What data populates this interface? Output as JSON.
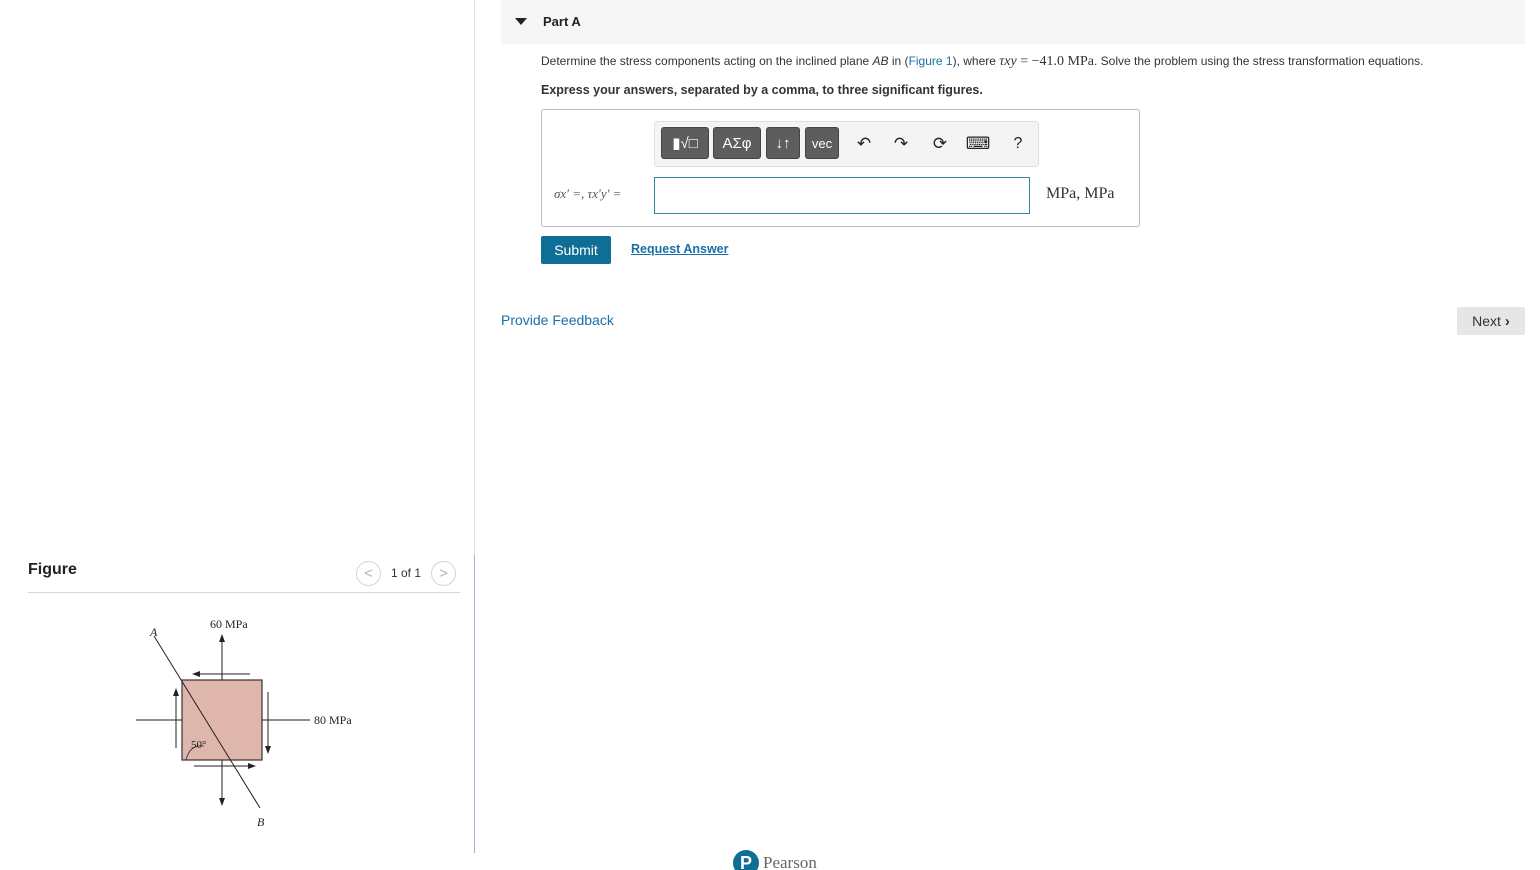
{
  "figure_pane": {
    "title": "Figure",
    "pager_label": "1 of 1",
    "prev_glyph": "<",
    "next_glyph": ">",
    "diagram": {
      "label_a": "A",
      "label_b": "B",
      "stress_top": "60 MPa",
      "stress_right": "80 MPa",
      "angle": "50°",
      "element_fill": "#dfb6ac"
    }
  },
  "part": {
    "title": "Part A",
    "question_prefix": "Determine the stress components acting on the inclined plane ",
    "question_plane": "AB",
    "question_mid": " in (",
    "figure_link": "Figure 1",
    "question_where": "), where ",
    "tau_symbol": "τxy",
    "tau_value": " = −41.0 MPa",
    "question_suffix": ". Solve the problem using the stress transformation equations.",
    "instruction": "Express your answers, separated by a comma, to three significant figures."
  },
  "answer": {
    "toolbar": {
      "templates_label": "▮√□",
      "greek_label": "ΑΣφ",
      "arrows_label": "↓↑",
      "vec_label": "vec",
      "undo_icon": "↶",
      "redo_icon": "↷",
      "reset_icon": "⟳",
      "keyboard_icon": "⌨",
      "help_label": "?"
    },
    "equation_label": "σx′ =, τx′y′ =",
    "input_value": "",
    "units": "MPa, MPa"
  },
  "actions": {
    "submit_label": "Submit",
    "request_label": "Request Answer",
    "feedback_label": "Provide Feedback",
    "next_label": "Next"
  },
  "footer": {
    "logo_letter": "P",
    "logo_text": "Pearson"
  },
  "colors": {
    "accent": "#0e6e95",
    "link": "#1a6fa8"
  }
}
